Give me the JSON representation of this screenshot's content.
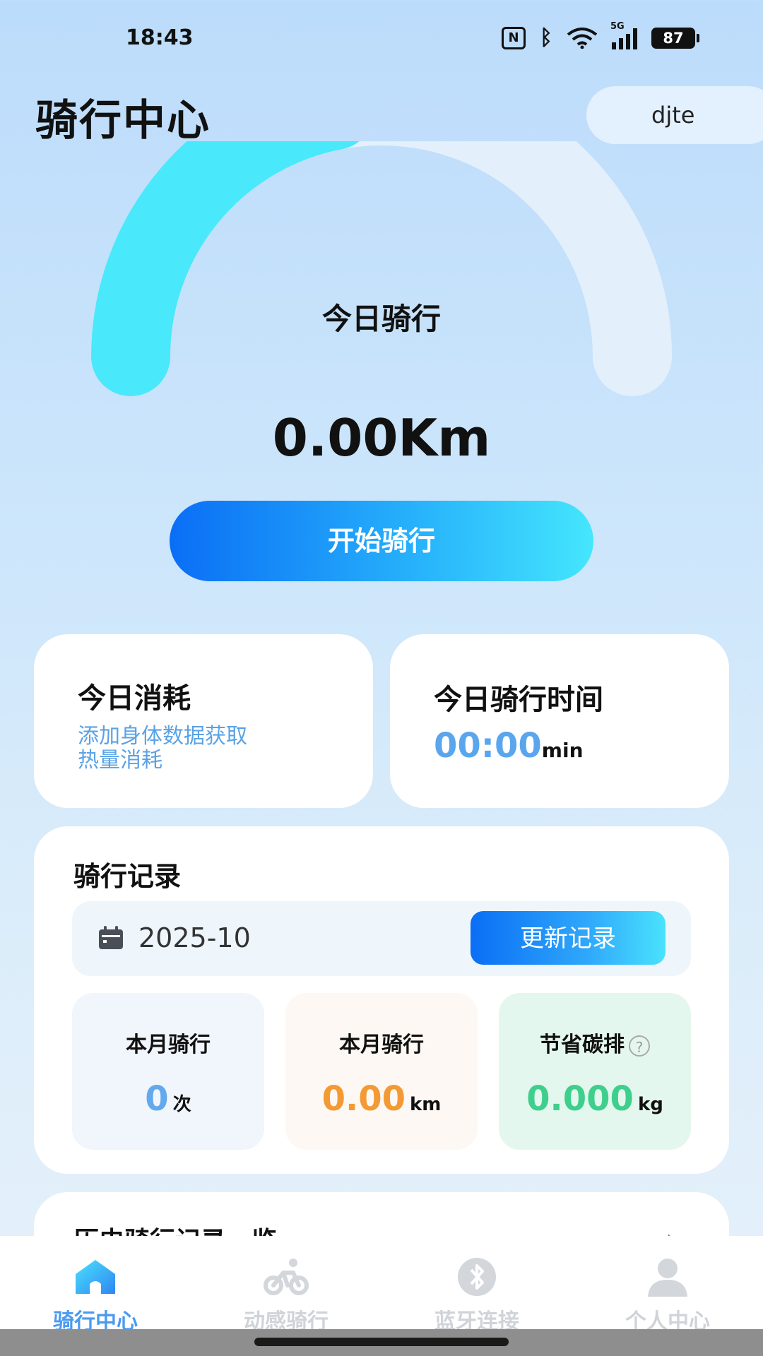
{
  "status_bar": {
    "time": "18:43",
    "signal_label": "5G",
    "battery": "87"
  },
  "header": {
    "title": "骑行中心",
    "user": "djte"
  },
  "gauge": {
    "label": "今日骑行",
    "value": "0.00Km",
    "fill_fraction": 0.44,
    "fill_color": "#4ae8fb",
    "track_color": "#e3f0fc"
  },
  "start_button": {
    "label": "开始骑行"
  },
  "calories_card": {
    "title": "今日消耗",
    "subtitle_line1": "添加身体数据获取",
    "subtitle_line2": "热量消耗"
  },
  "time_card": {
    "title": "今日骑行时间",
    "value": "00:00",
    "unit": "min"
  },
  "records": {
    "title": "骑行记录",
    "date": "2025-10",
    "update_label": "更新记录",
    "stats": [
      {
        "label": "本月骑行",
        "value": "0",
        "unit": "次",
        "color": "#63a9ee"
      },
      {
        "label": "本月骑行",
        "value": "0.00",
        "unit": "km",
        "color": "#f39a35"
      },
      {
        "label": "节省碳排",
        "value": "0.000",
        "unit": "kg",
        "color": "#3fcf8d",
        "help": "?"
      }
    ]
  },
  "history": {
    "title": "历史骑行记录一览"
  },
  "tabs": [
    {
      "label": "骑行中心",
      "icon": "home-icon",
      "active": true
    },
    {
      "label": "动感骑行",
      "icon": "bicycle-icon",
      "active": false
    },
    {
      "label": "蓝牙连接",
      "icon": "bluetooth-icon",
      "active": false
    },
    {
      "label": "个人中心",
      "icon": "person-icon",
      "active": false
    }
  ],
  "colors": {
    "accent": "#4a9af0",
    "button_gradient_start": "#0a6ef5",
    "button_gradient_end": "#45e6fd"
  }
}
